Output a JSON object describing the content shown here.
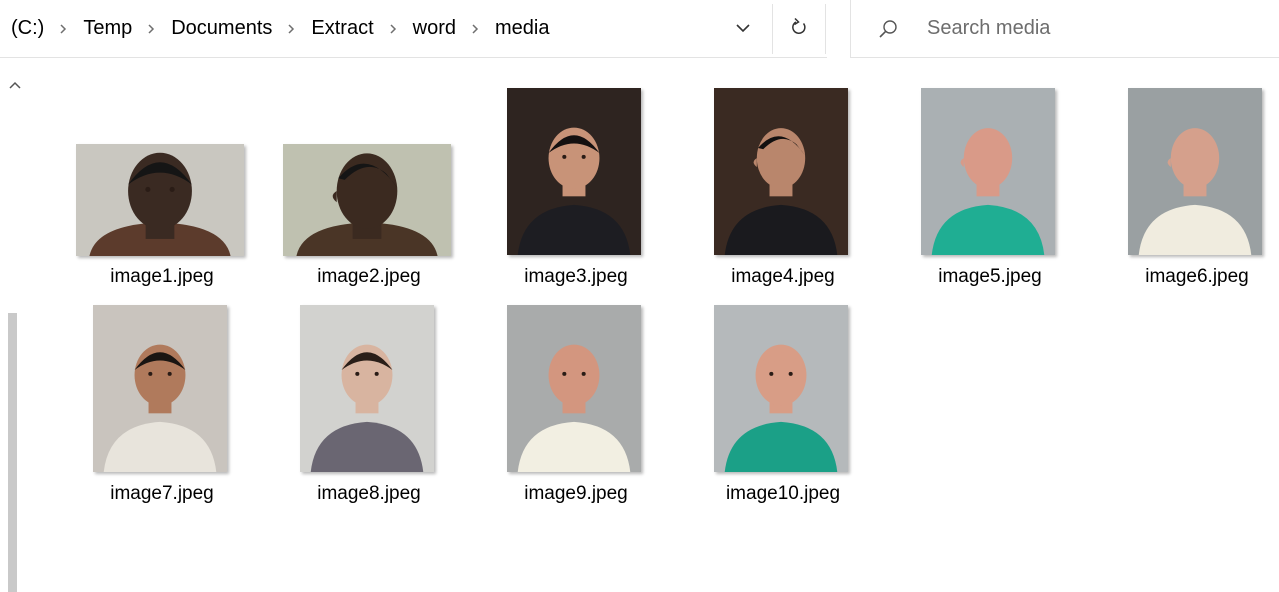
{
  "address_bar": {
    "crumbs": [
      "(C:)",
      "Temp",
      "Documents",
      "Extract",
      "word",
      "media"
    ],
    "dropdown_icon": "chevron-down-icon",
    "refresh_icon": "refresh-icon"
  },
  "search": {
    "placeholder": "Search media",
    "icon": "search-icon"
  },
  "files": [
    {
      "name": "image1.jpeg",
      "bg": "#c9c7c0",
      "skin": "#3a2a22",
      "hair": "#151515",
      "shirt": "#5c3b2c",
      "view": "front"
    },
    {
      "name": "image2.jpeg",
      "bg": "#bfc1b0",
      "skin": "#3b2a20",
      "hair": "#151515",
      "shirt": "#4a3526",
      "view": "side"
    },
    {
      "name": "image3.jpeg",
      "bg": "#2e2420",
      "skin": "#c89378",
      "hair": "#141010",
      "shirt": "#1d1d22",
      "view": "front"
    },
    {
      "name": "image4.jpeg",
      "bg": "#3a2a22",
      "skin": "#b9866c",
      "hair": "#121010",
      "shirt": "#1a1a1e",
      "view": "side"
    },
    {
      "name": "image5.jpeg",
      "bg": "#aab0b3",
      "skin": "#d99a88",
      "hair": "#d99a88",
      "shirt": "#1fae93",
      "view": "side"
    },
    {
      "name": "image6.jpeg",
      "bg": "#9aa0a2",
      "skin": "#d5a08c",
      "hair": "#d5a08c",
      "shirt": "#f0ecdf",
      "view": "side"
    },
    {
      "name": "image7.jpeg",
      "bg": "#c9c4be",
      "skin": "#b07a5c",
      "hair": "#1a1512",
      "shirt": "#e8e4dc",
      "view": "front"
    },
    {
      "name": "image8.jpeg",
      "bg": "#d2d2cf",
      "skin": "#d8b4a0",
      "hair": "#2a1e18",
      "shirt": "#6a6672",
      "view": "front"
    },
    {
      "name": "image9.jpeg",
      "bg": "#a9abab",
      "skin": "#d3967f",
      "hair": "#d3967f",
      "shirt": "#f2efe2",
      "view": "front"
    },
    {
      "name": "image10.jpeg",
      "bg": "#b5b9bb",
      "skin": "#d89d86",
      "hair": "#d89d86",
      "shirt": "#1ba087",
      "view": "front"
    }
  ]
}
